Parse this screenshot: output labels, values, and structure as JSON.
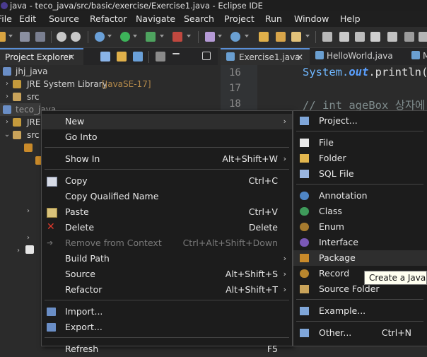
{
  "window": {
    "title": "java - teco_java/src/basic/exercise/Exercise1.java - Eclipse IDE"
  },
  "menubar": [
    "File",
    "Edit",
    "Source",
    "Refactor",
    "Navigate",
    "Search",
    "Project",
    "Run",
    "Window",
    "Help"
  ],
  "project_explorer": {
    "tab_label": "Project Explorer",
    "tab_close": "✕",
    "tree": [
      {
        "label": "jhj_java",
        "arrow": ""
      },
      {
        "label": "JRE System Library",
        "suffix": "[JavaSE-17]",
        "arrow": "›"
      },
      {
        "label": "src",
        "arrow": "›"
      },
      {
        "label": "teco_java",
        "arrow": "⌄"
      },
      {
        "label": "JRE",
        "arrow": "›"
      },
      {
        "label": "src",
        "arrow": "⌄"
      }
    ]
  },
  "editor": {
    "tabs": [
      "Exercise1.java",
      "HelloWorld.java",
      "M"
    ],
    "active_tab_close": "✕",
    "line_numbers": [
      "16",
      "17",
      "18"
    ],
    "code_line16": {
      "receiver": "System.",
      "field": "out",
      "call": ".println("
    },
    "code_line18": "//  int ageBox 상자에"
  },
  "context_menu": {
    "items": [
      {
        "label": "New",
        "shortcut": "",
        "submenu": true,
        "icon": "",
        "disabled": false
      },
      {
        "label": "Go Into",
        "shortcut": "",
        "submenu": false,
        "icon": "",
        "disabled": false
      },
      {
        "label": "Show In",
        "shortcut": "Alt+Shift+W",
        "submenu": true,
        "icon": "",
        "disabled": false
      },
      {
        "label": "Copy",
        "shortcut": "Ctrl+C",
        "submenu": false,
        "icon": "copy-icon",
        "disabled": false
      },
      {
        "label": "Copy Qualified Name",
        "shortcut": "",
        "submenu": false,
        "icon": "copy-qualified-icon",
        "disabled": false
      },
      {
        "label": "Paste",
        "shortcut": "Ctrl+V",
        "submenu": false,
        "icon": "paste-icon",
        "disabled": false
      },
      {
        "label": "Delete",
        "shortcut": "Delete",
        "submenu": false,
        "icon": "delete-icon",
        "disabled": false
      },
      {
        "label": "Remove from Context",
        "shortcut": "Ctrl+Alt+Shift+Down",
        "submenu": false,
        "icon": "remove-context-icon",
        "disabled": true
      },
      {
        "label": "Build Path",
        "shortcut": "",
        "submenu": true,
        "icon": "",
        "disabled": false
      },
      {
        "label": "Source",
        "shortcut": "Alt+Shift+S",
        "submenu": true,
        "icon": "",
        "disabled": false
      },
      {
        "label": "Refactor",
        "shortcut": "Alt+Shift+T",
        "submenu": true,
        "icon": "",
        "disabled": false
      },
      {
        "label": "Import...",
        "shortcut": "",
        "submenu": false,
        "icon": "import-icon",
        "disabled": false
      },
      {
        "label": "Export...",
        "shortcut": "",
        "submenu": false,
        "icon": "export-icon",
        "disabled": false
      },
      {
        "label": "Refresh",
        "shortcut": "F5",
        "submenu": false,
        "icon": "",
        "disabled": false
      }
    ],
    "submenu_arrow": "›"
  },
  "new_submenu": {
    "items": [
      {
        "label": "Project...",
        "shortcut": "",
        "icon": "new-project-icon"
      },
      {
        "label": "File",
        "shortcut": "",
        "icon": "file-icon"
      },
      {
        "label": "Folder",
        "shortcut": "",
        "icon": "folder-icon"
      },
      {
        "label": "SQL File",
        "shortcut": "",
        "icon": "sql-file-icon"
      },
      {
        "label": "Annotation",
        "shortcut": "",
        "icon": "annotation-icon"
      },
      {
        "label": "Class",
        "shortcut": "",
        "icon": "class-icon"
      },
      {
        "label": "Enum",
        "shortcut": "",
        "icon": "enum-icon"
      },
      {
        "label": "Interface",
        "shortcut": "",
        "icon": "interface-icon"
      },
      {
        "label": "Package",
        "shortcut": "",
        "icon": "package-icon"
      },
      {
        "label": "Record",
        "shortcut": "",
        "icon": "record-icon"
      },
      {
        "label": "Source Folder",
        "shortcut": "",
        "icon": "source-folder-icon"
      },
      {
        "label": "Example...",
        "shortcut": "",
        "icon": "example-icon"
      },
      {
        "label": "Other...",
        "shortcut": "Ctrl+N",
        "icon": "other-icon"
      }
    ],
    "highlighted": "Package"
  },
  "tooltip": {
    "text": "Create a Java pa"
  },
  "colors": {
    "menu_bg": "#1c1c1c",
    "highlight": "#2e2e2e",
    "keyword_blue": "#6fb7ff",
    "comment": "#7f8c8d",
    "accent": "#5a8fd6"
  }
}
